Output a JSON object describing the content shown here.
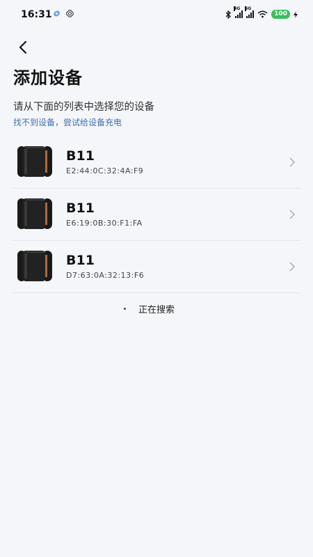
{
  "status_bar": {
    "time": "16:31",
    "signal1_tag": "4G",
    "signal2_tag": "5G",
    "battery": "100"
  },
  "header": {
    "title": "添加设备"
  },
  "content": {
    "subtitle": "请从下面的列表中选择您的设备",
    "help_link": "找不到设备，尝试给设备充电"
  },
  "devices": [
    {
      "name": "B11",
      "mac": "E2:44:0C:32:4A:F9"
    },
    {
      "name": "B11",
      "mac": "E6:19:0B:30:F1:FA"
    },
    {
      "name": "B11",
      "mac": "D7:63:0A:32:13:F6"
    }
  ],
  "footer": {
    "searching_label": "正在搜索"
  },
  "colors": {
    "background": "#f5f6fa",
    "link": "#3f6fb0",
    "battery": "#38c05a"
  }
}
